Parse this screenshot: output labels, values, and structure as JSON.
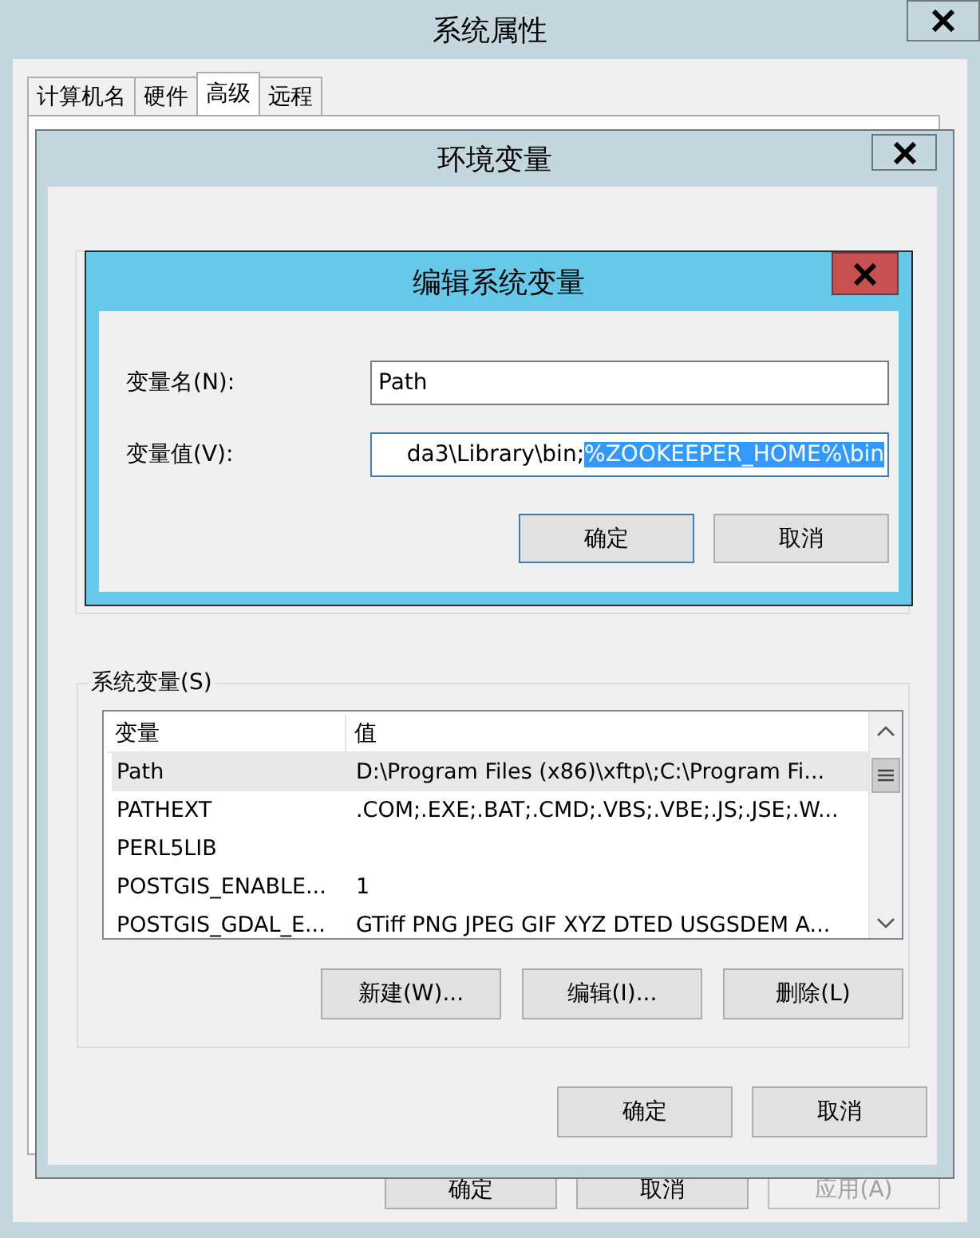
{
  "window": {
    "title": "系统属性"
  },
  "tabs": [
    {
      "label": "计算机名",
      "selected": false
    },
    {
      "label": "硬件",
      "selected": false
    },
    {
      "label": "高级",
      "selected": true
    },
    {
      "label": "远程",
      "selected": false
    }
  ],
  "footer_buttons": [
    {
      "label": "确定",
      "disabled": false
    },
    {
      "label": "取消",
      "disabled": false
    },
    {
      "label": "应用(A)",
      "disabled": true
    }
  ],
  "env_dialog": {
    "title": "环境变量",
    "system_variables": {
      "label": "系统变量(S)",
      "columns": [
        "变量",
        "值"
      ],
      "rows": [
        {
          "name": "Path",
          "value": "D:\\Program Files (x86)\\xftp\\;C:\\Program Fi...",
          "selected": true
        },
        {
          "name": "PATHEXT",
          "value": ".COM;.EXE;.BAT;.CMD;.VBS;.VBE;.JS;.JSE;.W...",
          "selected": false
        },
        {
          "name": "PERL5LIB",
          "selected": false
        },
        {
          "name": "POSTGIS_ENABLE...",
          "value": "1",
          "selected": false
        },
        {
          "name": "POSTGIS_GDAL_E...",
          "value": "GTiff PNG JPEG GIF XYZ DTED USGSDEM A...",
          "selected": false
        }
      ],
      "buttons": [
        "新建(W)...",
        "编辑(I)...",
        "删除(L)"
      ]
    },
    "buttons": [
      "确定",
      "取消"
    ]
  },
  "edit_dialog": {
    "title": "编辑系统变量",
    "fields": [
      {
        "label": "变量名(N):",
        "value": "Path"
      },
      {
        "label": "变量值(V):",
        "value": "da3\\Library\\bin;",
        "selection": "%ZOOKEEPER_HOME%\\bin"
      }
    ],
    "buttons": [
      {
        "label": "确定",
        "focused": true
      },
      {
        "label": "取消",
        "focused": false
      }
    ]
  }
}
